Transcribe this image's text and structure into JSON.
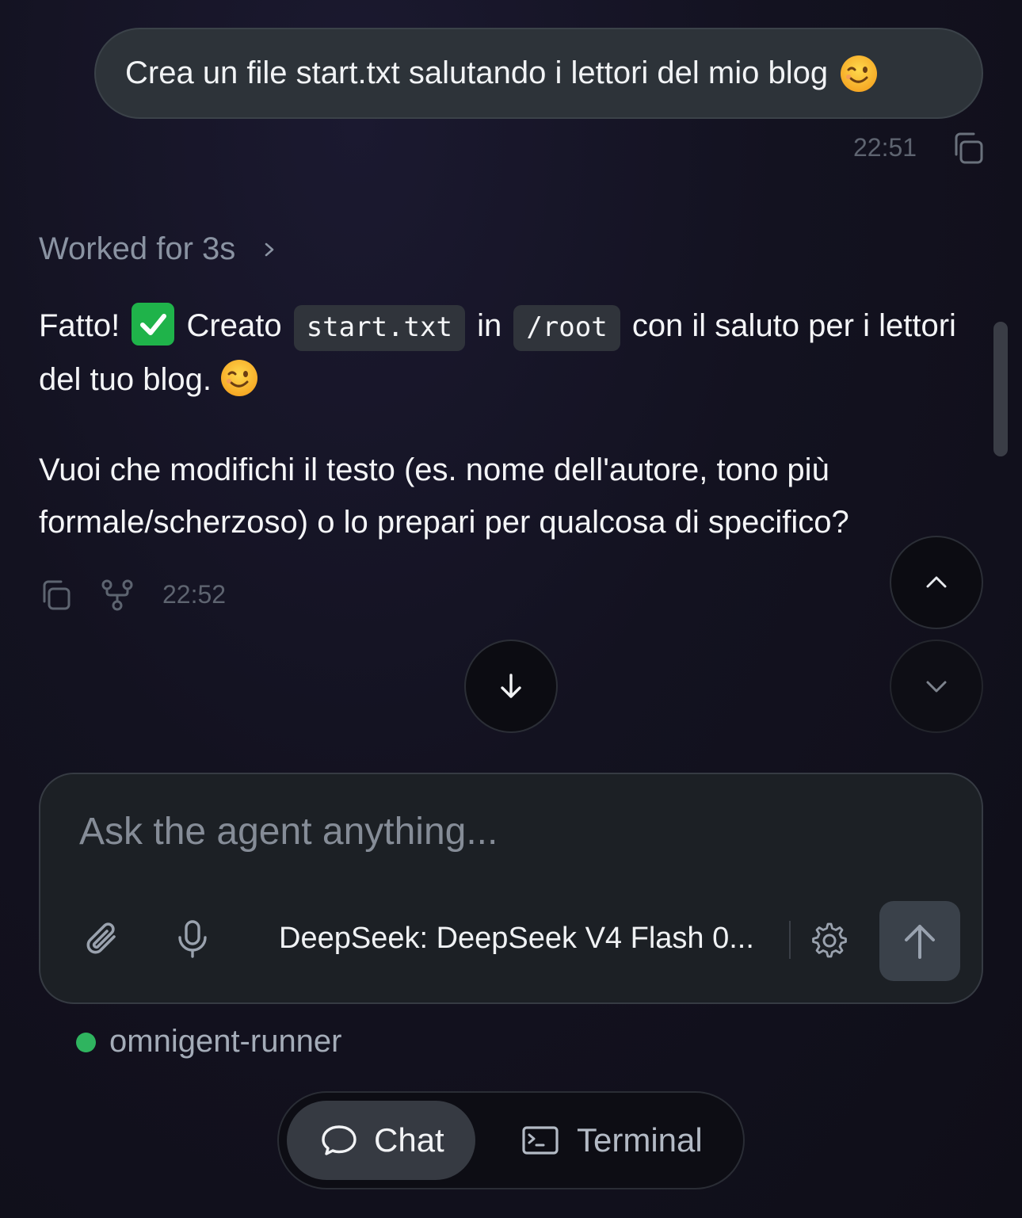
{
  "user_message": {
    "text": "Crea un file start.txt salutando i lettori del mio blog",
    "emoji": "winking-face",
    "time": "22:51"
  },
  "worked_for": {
    "label": "Worked for 3s"
  },
  "assistant_message": {
    "p1_a": "Fatto!",
    "p1_b": "Creato",
    "code1": "start.txt",
    "p1_c": "in",
    "code2": "/root",
    "p1_d": "con il saluto per i lettori del tuo blog.",
    "p2": "Vuoi che modifichi il testo (es. nome dell'autore, tono più formale/scherzoso) o lo prepari per qualcosa di specifico?",
    "time": "22:52"
  },
  "composer": {
    "placeholder": "Ask the agent anything...",
    "model": "DeepSeek: DeepSeek V4 Flash 0..."
  },
  "runner": {
    "name": "omnigent-runner",
    "status_color": "#2fb45f"
  },
  "tabs": {
    "chat": "Chat",
    "terminal": "Terminal"
  },
  "colors": {
    "success_check": "#1fb34a"
  }
}
